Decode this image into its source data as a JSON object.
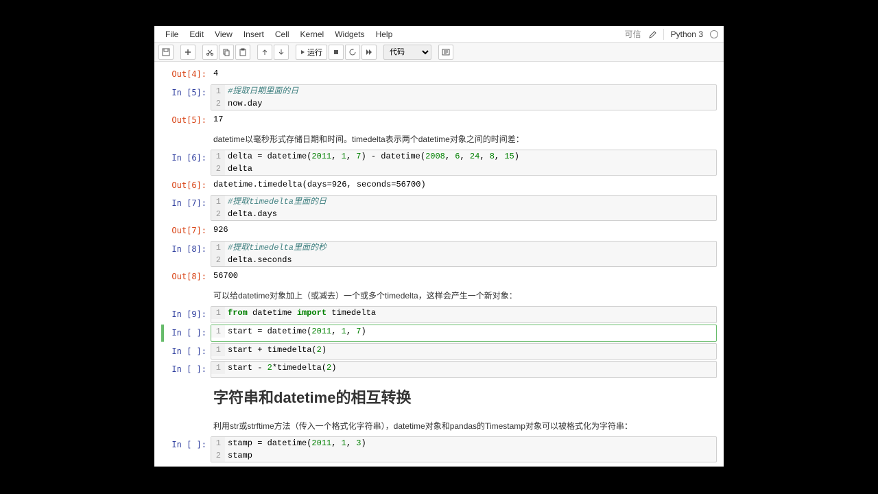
{
  "menubar": {
    "items": [
      "File",
      "Edit",
      "View",
      "Insert",
      "Cell",
      "Kernel",
      "Widgets",
      "Help"
    ],
    "kernel_status": "可信",
    "kernel_name": "Python 3"
  },
  "toolbar": {
    "run_label": "运行",
    "cell_type": "代码"
  },
  "cells": [
    {
      "type": "out",
      "prompt": "Out[4]:",
      "text": "4"
    },
    {
      "type": "code",
      "prompt": "In [5]:",
      "lines": [
        [
          {
            "t": "#提取日期里面的日",
            "c": "comment"
          }
        ],
        [
          {
            "t": "now.day",
            "c": ""
          }
        ]
      ]
    },
    {
      "type": "out",
      "prompt": "Out[5]:",
      "text": "17"
    },
    {
      "type": "md",
      "text": "datetime以毫秒形式存储日期和时间。timedelta表示两个datetime对象之间的时间差："
    },
    {
      "type": "code",
      "prompt": "In [6]:",
      "lines": [
        [
          {
            "t": "delta = datetime(",
            "c": ""
          },
          {
            "t": "2011",
            "c": "num"
          },
          {
            "t": ", ",
            "c": ""
          },
          {
            "t": "1",
            "c": "num"
          },
          {
            "t": ", ",
            "c": ""
          },
          {
            "t": "7",
            "c": "num"
          },
          {
            "t": ") - datetime(",
            "c": ""
          },
          {
            "t": "2008",
            "c": "num"
          },
          {
            "t": ", ",
            "c": ""
          },
          {
            "t": "6",
            "c": "num"
          },
          {
            "t": ", ",
            "c": ""
          },
          {
            "t": "24",
            "c": "num"
          },
          {
            "t": ", ",
            "c": ""
          },
          {
            "t": "8",
            "c": "num"
          },
          {
            "t": ", ",
            "c": ""
          },
          {
            "t": "15",
            "c": "num"
          },
          {
            "t": ")",
            "c": ""
          }
        ],
        [
          {
            "t": "delta",
            "c": ""
          }
        ]
      ]
    },
    {
      "type": "out",
      "prompt": "Out[6]:",
      "text": "datetime.timedelta(days=926, seconds=56700)"
    },
    {
      "type": "code",
      "prompt": "In [7]:",
      "lines": [
        [
          {
            "t": "#提取timedelta里面的日",
            "c": "comment"
          }
        ],
        [
          {
            "t": "delta.days",
            "c": ""
          }
        ]
      ]
    },
    {
      "type": "out",
      "prompt": "Out[7]:",
      "text": "926"
    },
    {
      "type": "code",
      "prompt": "In [8]:",
      "lines": [
        [
          {
            "t": "#提取timedelta里面的秒",
            "c": "comment"
          }
        ],
        [
          {
            "t": "delta.seconds",
            "c": ""
          }
        ]
      ]
    },
    {
      "type": "out",
      "prompt": "Out[8]:",
      "text": "56700"
    },
    {
      "type": "md",
      "text": "可以给datetime对象加上（或减去）一个或多个timedelta，这样会产生一个新对象："
    },
    {
      "type": "code",
      "prompt": "In [9]:",
      "lines": [
        [
          {
            "t": "from",
            "c": "kw"
          },
          {
            "t": " datetime ",
            "c": ""
          },
          {
            "t": "import",
            "c": "kw"
          },
          {
            "t": " timedelta",
            "c": ""
          }
        ]
      ]
    },
    {
      "type": "code",
      "prompt": "In [ ]:",
      "selected": true,
      "lines": [
        [
          {
            "t": "start = datetime(",
            "c": ""
          },
          {
            "t": "2011",
            "c": "num"
          },
          {
            "t": ", ",
            "c": ""
          },
          {
            "t": "1",
            "c": "num"
          },
          {
            "t": ", ",
            "c": ""
          },
          {
            "t": "7",
            "c": "num"
          },
          {
            "t": ")",
            "c": ""
          }
        ]
      ]
    },
    {
      "type": "code",
      "prompt": "In [ ]:",
      "lines": [
        [
          {
            "t": "start + timedelta(",
            "c": ""
          },
          {
            "t": "2",
            "c": "num"
          },
          {
            "t": ")",
            "c": ""
          }
        ]
      ]
    },
    {
      "type": "code",
      "prompt": "In [ ]:",
      "lines": [
        [
          {
            "t": "start - ",
            "c": ""
          },
          {
            "t": "2",
            "c": "num"
          },
          {
            "t": "*timedelta(",
            "c": ""
          },
          {
            "t": "2",
            "c": "num"
          },
          {
            "t": ")",
            "c": ""
          }
        ]
      ]
    },
    {
      "type": "md_h1",
      "text": "字符串和datetime的相互转换"
    },
    {
      "type": "md",
      "text": "利用str或strftime方法（传入一个格式化字符串），datetime对象和pandas的Timestamp对象可以被格式化为字符串："
    },
    {
      "type": "code",
      "prompt": "In [ ]:",
      "lines": [
        [
          {
            "t": "stamp = datetime(",
            "c": ""
          },
          {
            "t": "2011",
            "c": "num"
          },
          {
            "t": ", ",
            "c": ""
          },
          {
            "t": "1",
            "c": "num"
          },
          {
            "t": ", ",
            "c": ""
          },
          {
            "t": "3",
            "c": "num"
          },
          {
            "t": ")",
            "c": ""
          }
        ],
        [
          {
            "t": "stamp",
            "c": ""
          }
        ]
      ]
    }
  ]
}
